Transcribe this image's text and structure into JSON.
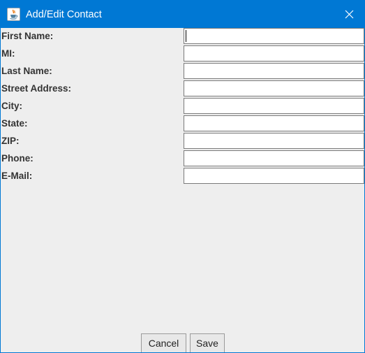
{
  "window": {
    "title": "Add/Edit Contact"
  },
  "form": {
    "fields": [
      {
        "label": "First Name:",
        "value": ""
      },
      {
        "label": "MI:",
        "value": ""
      },
      {
        "label": "Last Name:",
        "value": ""
      },
      {
        "label": "Street Address:",
        "value": ""
      },
      {
        "label": "City:",
        "value": ""
      },
      {
        "label": "State:",
        "value": ""
      },
      {
        "label": "ZIP:",
        "value": ""
      },
      {
        "label": "Phone:",
        "value": ""
      },
      {
        "label": "E-Mail:",
        "value": ""
      }
    ]
  },
  "buttons": {
    "cancel_label": "Cancel",
    "save_label": "Save"
  },
  "icons": {
    "app": "java-coffee-cup-icon",
    "close": "close-icon"
  },
  "colors": {
    "titlebar": "#0078d4",
    "panel_background": "#eeeeee",
    "input_border": "#7a7a7a"
  }
}
